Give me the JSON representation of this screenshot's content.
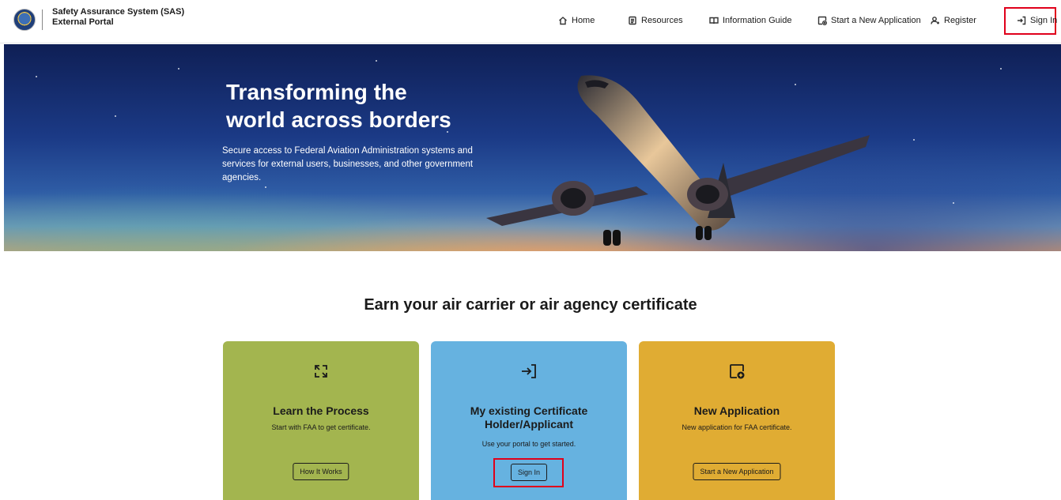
{
  "header": {
    "brand_line1": "Safety Assurance System (SAS)",
    "brand_line2": "External Portal",
    "nav": {
      "home": "Home",
      "resources": "Resources",
      "guide": "Information Guide",
      "new_application": "Start a New Application",
      "register": "Register",
      "sign_in": "Sign In"
    }
  },
  "hero": {
    "title_line1": "Transforming the",
    "title_line2": "world across borders",
    "subtitle": "Secure access to Federal Aviation Administration systems and services for external users, businesses, and other government agencies."
  },
  "section": {
    "title": "Earn your air carrier or air agency certificate"
  },
  "cards": [
    {
      "icon": "refresh-arrows-icon",
      "title": "Learn the Process",
      "desc": "Start with FAA to get certificate.",
      "button": "How It Works"
    },
    {
      "icon": "sign-in-arrow-icon",
      "title_line1": "My existing Certificate",
      "title_line2": "Holder/Applicant",
      "desc": "Use your portal to get started.",
      "button": "Sign In"
    },
    {
      "icon": "new-document-plus-icon",
      "title": "New Application",
      "desc": "New application for FAA certificate.",
      "button": "Start a New Application"
    }
  ],
  "colors": {
    "card_learn": "#a3b54f",
    "card_existing": "#66b2e0",
    "card_new": "#e0ac33",
    "highlight": "#e0001b"
  }
}
